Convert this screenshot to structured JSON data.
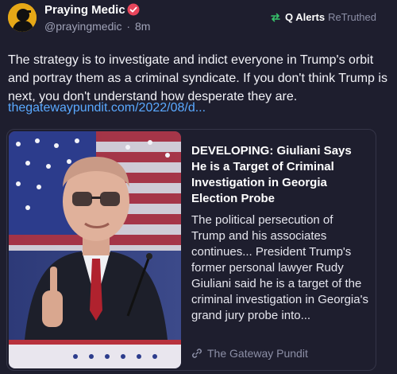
{
  "author": {
    "display_name": "Praying Medic",
    "handle": "@prayingmedic",
    "separator": "·",
    "time_ago": "8m",
    "verified_icon": "verified-badge-icon"
  },
  "retruth": {
    "icon": "retruth-icon",
    "by": "Q Alerts",
    "action": "ReTruthed"
  },
  "post": {
    "text": "The strategy is to investigate and indict everyone in Trump's orbit and portray them as a criminal syndicate. If you don't think Trump is next, you don't understand how desperate they are.",
    "link": "thegatewaypundit.com/2022/08/d..."
  },
  "card": {
    "title": "DEVELOPING: Giuliani Says He is a Target of Criminal Investigation in Georgia Election Probe",
    "description": "The political persecution of Trump and his associates continues... President Trump's former personal lawyer Rudy Giuliani said he is a target of the criminal investigation in Georgia's grand jury probe into...",
    "source": "The Gateway Pundit",
    "source_icon": "link-icon"
  },
  "colors": {
    "background": "#1e1e2e",
    "link": "#5aa9ff",
    "verified": "#e8455b",
    "retruth": "#37c06a",
    "muted": "#8c8fa6"
  }
}
